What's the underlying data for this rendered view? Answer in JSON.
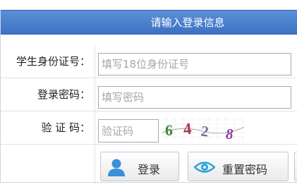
{
  "header": {
    "title": "请输入登录信息"
  },
  "fields": {
    "student_id": {
      "label": "学生身份证号：",
      "placeholder": "填写18位身份证号",
      "value": ""
    },
    "password": {
      "label": "登录密码：",
      "placeholder": "填写密码",
      "value": ""
    },
    "captcha": {
      "label": "验 证 码：",
      "placeholder": "验证码",
      "value": "",
      "image_text": "6428"
    }
  },
  "buttons": {
    "login": {
      "label": "登录",
      "icon": "user-icon"
    },
    "reset_password": {
      "label": "重置密码",
      "icon": "eye-icon"
    },
    "extra": {
      "icon": "arrow-up-icon"
    }
  },
  "colors": {
    "header_bg": "#4a80cd",
    "header_text": "#ffffff",
    "icon_blue": "#3a8fd9",
    "captcha_6": "#3b8a3e",
    "captcha_4": "#a8324a",
    "captcha_2": "#6b6b9e",
    "captcha_8": "#8b3aa8"
  }
}
